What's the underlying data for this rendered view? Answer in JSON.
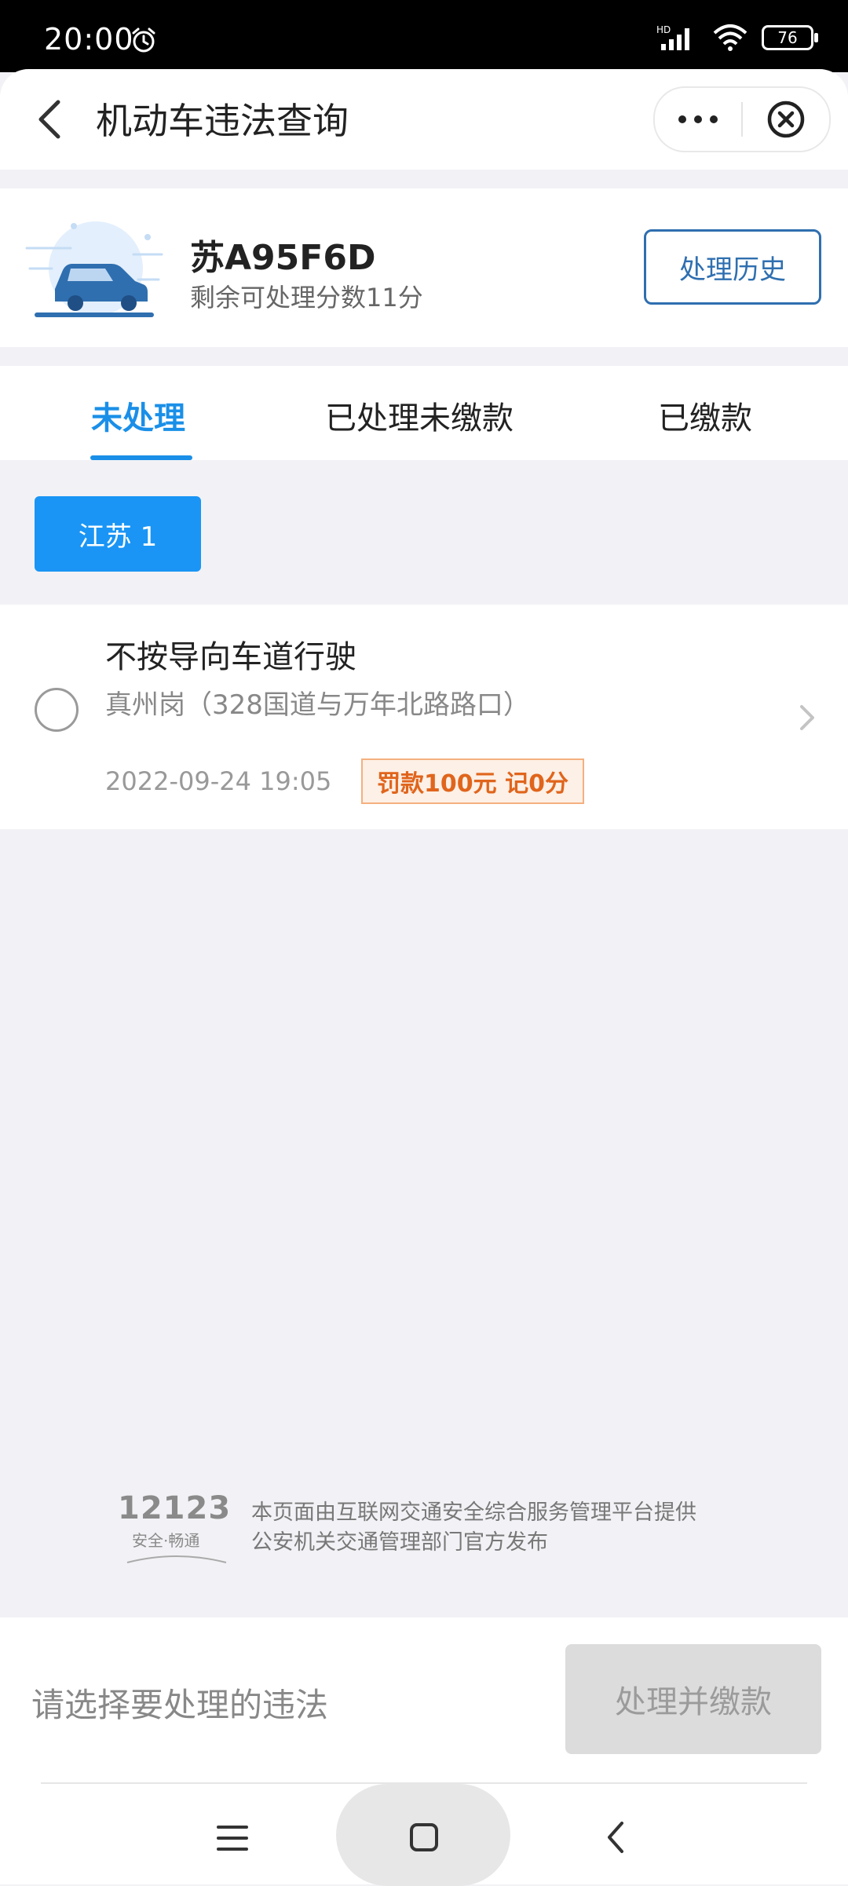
{
  "status_bar": {
    "time": "20:00",
    "network_label": "HD",
    "battery": "76",
    "icons": [
      "alarm-icon",
      "signal-icon",
      "wifi-icon",
      "battery-icon"
    ]
  },
  "header": {
    "title": "机动车违法查询",
    "icons": [
      "back-arrow-icon",
      "more-dots-icon",
      "close-circle-icon"
    ]
  },
  "vehicle": {
    "plate": "苏A95F6D",
    "points_text": "剩余可处理分数11分",
    "history_button": "处理历史",
    "icon": "car-icon"
  },
  "tabs": [
    {
      "label": "未处理",
      "active": true
    },
    {
      "label": "已处理未缴款",
      "active": false
    },
    {
      "label": "已缴款",
      "active": false
    }
  ],
  "region_filter": {
    "label": "江苏 1"
  },
  "violations": [
    {
      "title": "不按导向车道行驶",
      "location": "真州岗（328国道与万年北路路口）",
      "time": "2022-09-24 19:05",
      "penalty": "罚款100元 记0分"
    }
  ],
  "footer": {
    "logo": "12123",
    "slogan": "安全·畅通",
    "line1": "本页面由互联网交通安全综合服务管理平台提供",
    "line2": "公安机关交通管理部门官方发布"
  },
  "bottom": {
    "prompt": "请选择要处理的违法",
    "pay_button": "处理并缴款"
  },
  "nav_bar": {
    "icons": [
      "menu-icon",
      "home-icon",
      "back-icon"
    ]
  },
  "colors": {
    "accent": "#1a8fe8",
    "chip": "#1a95f5",
    "history_border": "#2f6fb0",
    "penalty_text": "#e0651c",
    "penalty_bg": "#fdf0e6"
  }
}
